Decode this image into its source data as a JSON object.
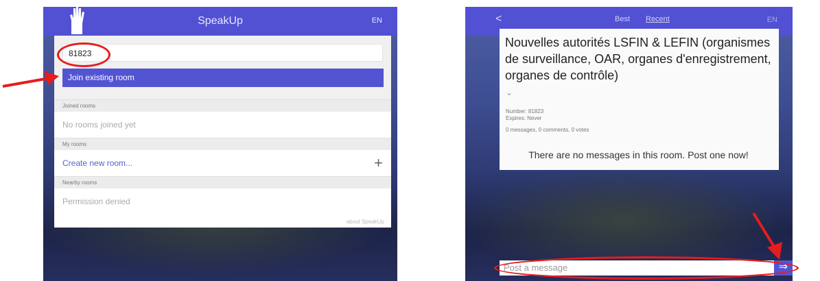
{
  "left_screen": {
    "app_title": "SpeakUp",
    "language": "EN",
    "room_input_value": "81823",
    "join_button_label": "Join existing room",
    "sections": {
      "joined_header": "Joined rooms",
      "joined_empty": "No rooms joined yet",
      "my_header": "My rooms",
      "create_room": "Create new room...",
      "nearby_header": "Nearby rooms",
      "nearby_status": "Permission denied"
    },
    "plus_icon": "+",
    "about_link": "about SpeakUp"
  },
  "right_screen": {
    "back_icon": "<",
    "tabs": {
      "best": "Best",
      "recent": "Recent"
    },
    "language": "EN",
    "room": {
      "title": "Nouvelles autorités LSFIN & LEFIN (organismes de surveillance, OAR, organes d'enregistrement, organes de contrôle)",
      "expand_icon": "⌄",
      "number": "Number: 81823",
      "expires": "Expires: Never",
      "counts": "0 messages, 0 comments, 0 votes",
      "empty_message": "There are no messages in this room. Post one now!"
    },
    "post_placeholder": "Post a message",
    "send_icon": "⇒"
  },
  "colors": {
    "topbar": "#5251d3",
    "button": "#5354d2",
    "annotation_red": "#e51d1d"
  }
}
